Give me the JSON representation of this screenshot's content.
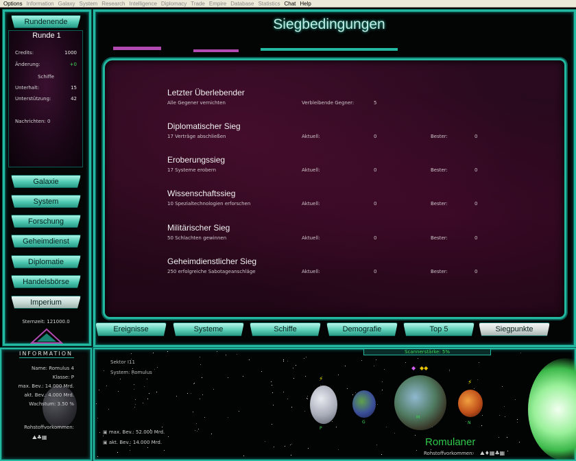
{
  "menubar": {
    "items": [
      {
        "label": "Options",
        "active": true
      },
      {
        "label": "Information",
        "active": false
      },
      {
        "label": "Galaxy",
        "active": false
      },
      {
        "label": "System",
        "active": false
      },
      {
        "label": "Research",
        "active": false
      },
      {
        "label": "Intelligence",
        "active": false
      },
      {
        "label": "Diplomacy",
        "active": false
      },
      {
        "label": "Trade",
        "active": false
      },
      {
        "label": "Empire",
        "active": false
      },
      {
        "label": "Database",
        "active": false
      },
      {
        "label": "Statistics",
        "active": false
      },
      {
        "label": "Chat",
        "active": true
      },
      {
        "label": "Help",
        "active": true
      }
    ]
  },
  "left_panel": {
    "end_turn_label": "Rundenende",
    "round_label": "Runde 1",
    "credits_label": "Credits:",
    "credits_value": "1000",
    "change_label": "Änderung:",
    "change_value": "+0",
    "ships_header": "Schiffe",
    "upkeep_label": "Unterhalt:",
    "upkeep_value": "15",
    "support_label": "Unterstützung:",
    "support_value": "42",
    "messages": "Nachrichten: 0",
    "nav": [
      "Galaxie",
      "System",
      "Forschung",
      "Geheimdienst",
      "Diplomatie",
      "Handelsbörse",
      "Imperium"
    ],
    "stardate": "Sternzeit: 121000.0"
  },
  "main": {
    "title": "Siegbedingungen",
    "conditions": [
      {
        "name": "Letzter Überlebender",
        "desc": "Alle Gegener vernichten",
        "l1": "Verbleibende Gegner:",
        "v1": "5",
        "l2": "",
        "v2": ""
      },
      {
        "name": "Diplomatischer Sieg",
        "desc": "17 Verträge abschließen",
        "l1": "Aktuell:",
        "v1": "0",
        "l2": "Bester:",
        "v2": "0"
      },
      {
        "name": "Eroberungssieg",
        "desc": "17 Systeme erobern",
        "l1": "Aktuell:",
        "v1": "0",
        "l2": "Bester:",
        "v2": "0"
      },
      {
        "name": "Wissenschaftssieg",
        "desc": "10 Spezialtechnologien erforschen",
        "l1": "Aktuell:",
        "v1": "0",
        "l2": "Bester:",
        "v2": "0"
      },
      {
        "name": "Militärischer Sieg",
        "desc": "50 Schlachten gewinnen",
        "l1": "Aktuell:",
        "v1": "0",
        "l2": "Bester:",
        "v2": "0"
      },
      {
        "name": "Geheimdienstlicher Sieg",
        "desc": "250 erfolgreiche Sabotageanschläge",
        "l1": "Aktuell:",
        "v1": "0",
        "l2": "Bester:",
        "v2": "0"
      }
    ],
    "tabs": [
      {
        "label": "Ereignisse",
        "selected": false
      },
      {
        "label": "Systeme",
        "selected": false
      },
      {
        "label": "Schiffe",
        "selected": false
      },
      {
        "label": "Demografie",
        "selected": false
      },
      {
        "label": "Top 5",
        "selected": false
      },
      {
        "label": "Siegpunkte",
        "selected": true
      }
    ]
  },
  "info": {
    "title": "INFORMATION",
    "name": "Name: Romulus 4",
    "class": "Klasse: P",
    "max_pop": "max. Bev.: 14.000 Mrd.",
    "cur_pop": "akt. Bev.: 4.000 Mrd.",
    "growth": "Wachstum: 3.50 %",
    "resources": "Rohstoffvorkommen:"
  },
  "system_view": {
    "scanner": "Scannerstärke: 5%",
    "sector": "Sektor I11",
    "system": "System: Romulus",
    "max_pop": "max. Bev.: 52.000 Mrd.",
    "cur_pop": "akt. Bev.: 14.000 Mrd.",
    "race": "Romulaner",
    "resources": "Rohstoffvorkommen:",
    "planet_labels": [
      "P",
      "G",
      "M",
      "N"
    ]
  }
}
